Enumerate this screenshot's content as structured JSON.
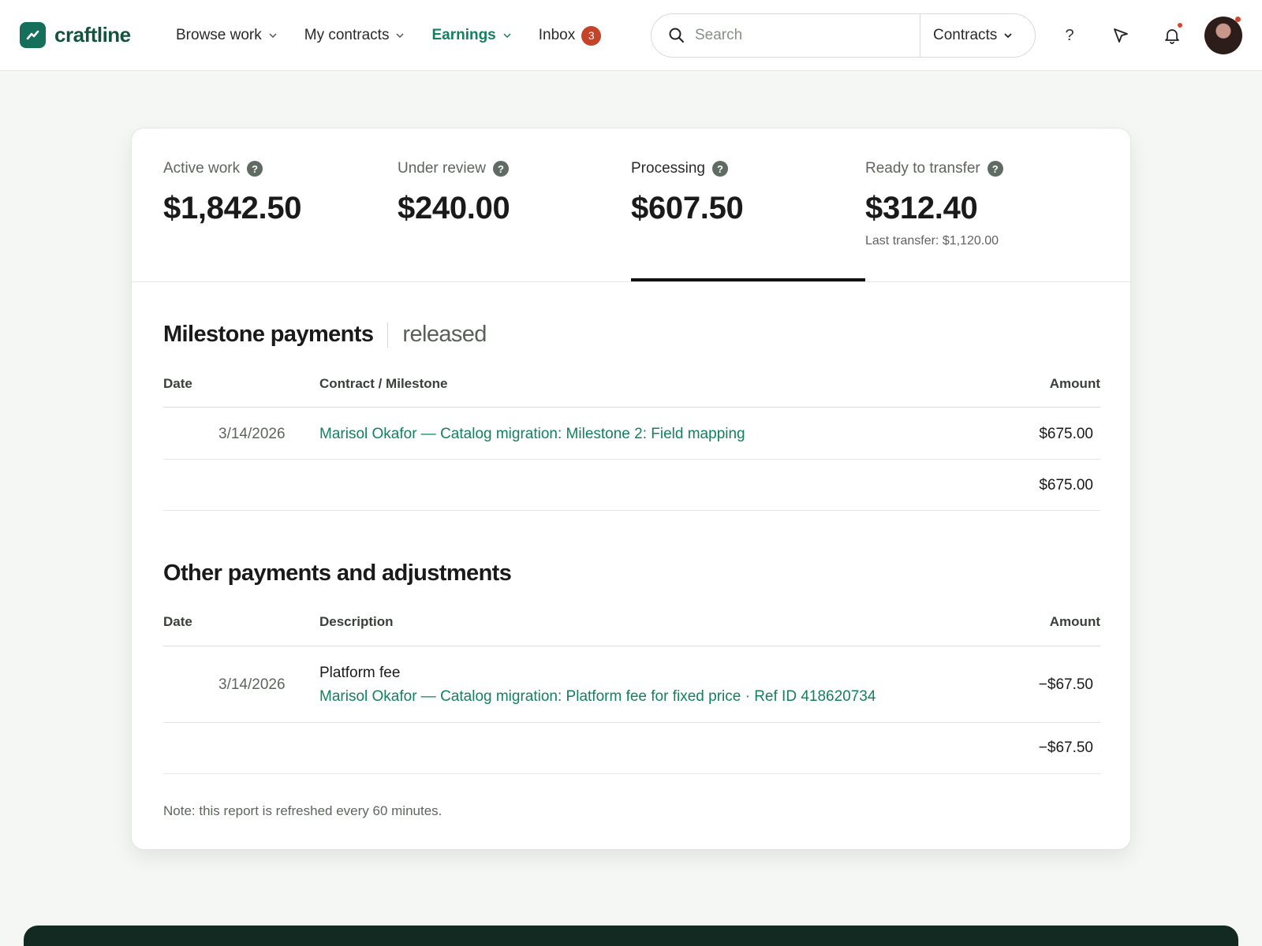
{
  "brand": {
    "name": "craftline",
    "color": "#14705a"
  },
  "nav": {
    "items": [
      {
        "label": "Browse work",
        "active": false
      },
      {
        "label": "My contracts",
        "active": false
      },
      {
        "label": "Earnings",
        "active": true
      }
    ],
    "inbox": {
      "label": "Inbox",
      "count": "3"
    }
  },
  "search": {
    "placeholder": "Search",
    "scope": "Contracts"
  },
  "header_icons": [
    "help-icon",
    "cursor-icon",
    "bell-icon"
  ],
  "stats": [
    {
      "label": "Active work",
      "value": "$1,842.50",
      "sub": ""
    },
    {
      "label": "Under review",
      "value": "$240.00",
      "sub": ""
    },
    {
      "label": "Processing",
      "value": "$607.50",
      "sub": ""
    },
    {
      "label": "Ready to transfer",
      "value": "$312.40",
      "sub": "Last transfer: $1,120.00"
    }
  ],
  "active_stat": "Processing",
  "milestones": {
    "title": "Milestone payments",
    "subtitle": "released",
    "headers": {
      "date": "Date",
      "desc": "Contract / Milestone",
      "amount": "Amount"
    },
    "rows": [
      {
        "date": "3/14/2026",
        "desc": "Marisol Okafor — Catalog migration: Milestone 2: Field mapping",
        "amount": "$675.00"
      }
    ],
    "total": "$675.00"
  },
  "other": {
    "title": "Other payments and adjustments",
    "headers": {
      "date": "Date",
      "desc": "Description",
      "amount": "Amount"
    },
    "rows": [
      {
        "date": "3/14/2026",
        "title": "Platform fee",
        "desc": "Marisol Okafor — Catalog migration: Platform fee for fixed price · Ref ID 418620734",
        "amount": "−$67.50"
      }
    ],
    "total": "−$67.50"
  },
  "note": "Note: this report is refreshed every 60 minutes.",
  "colors": {
    "accent": "#14805f",
    "badge": "#c4442a",
    "footer": "#132a22"
  }
}
